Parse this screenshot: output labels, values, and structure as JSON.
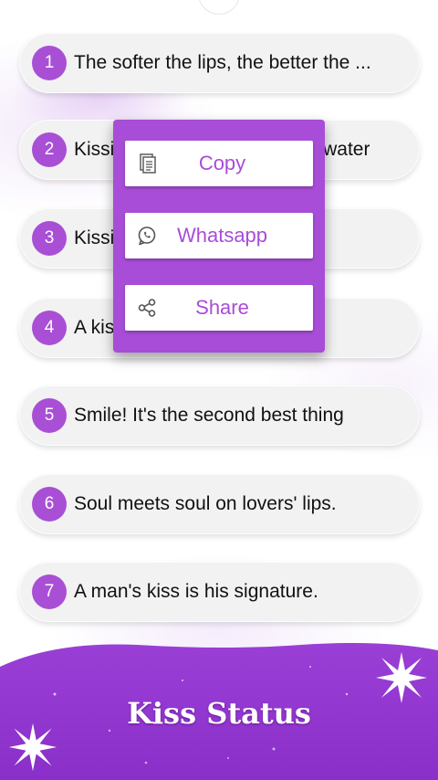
{
  "list": {
    "items": [
      {
        "number": "1",
        "text": "The softer the lips, the better the ..."
      },
      {
        "number": "2",
        "text": "Kissing is like drinking salted water"
      },
      {
        "number": "3",
        "text": "Kissing is like drinking honey"
      },
      {
        "number": "4",
        "text": "A kiss without a hug is like"
      },
      {
        "number": "5",
        "text": "Smile! It's the second best thing"
      },
      {
        "number": "6",
        "text": "Soul meets soul on lovers' lips."
      },
      {
        "number": "7",
        "text": "A man's kiss is his signature."
      }
    ]
  },
  "popup": {
    "copy_label": "Copy",
    "whatsapp_label": "Whatsapp",
    "share_label": "Share"
  },
  "footer": {
    "title": "Kiss Status"
  },
  "colors": {
    "accent": "#a84dd8",
    "badge": "#a94fd6",
    "footer_purple": "#8a2fc9"
  },
  "icons": {
    "copy": "document-icon",
    "whatsapp": "whatsapp-icon",
    "share": "share-icon",
    "sparkle": "sparkle-icon"
  }
}
